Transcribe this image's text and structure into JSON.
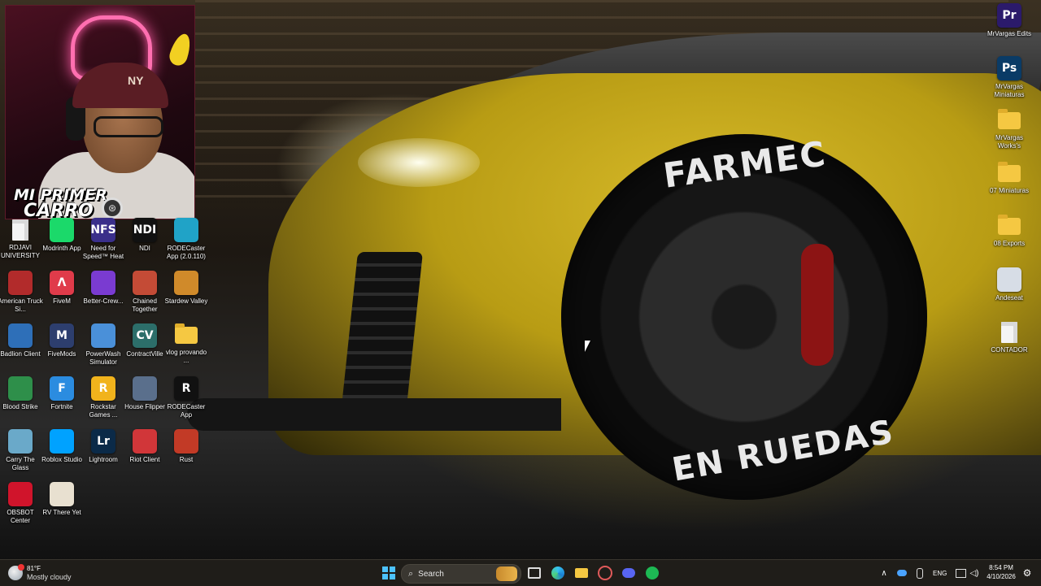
{
  "webcam": {
    "title_line1": "MI PRIMER",
    "title_line2": "CARRO",
    "cap_logo": "NY"
  },
  "wallpaper": {
    "tire_text_top": "FARMEC",
    "tire_text_bottom": "EN RUEDAS"
  },
  "desktop_icons_left": [
    {
      "label": "RDJAVI UNIVERSITY",
      "icon": "document-icon",
      "color": "#f2f2f2"
    },
    {
      "label": "Modrinth App",
      "icon": "modrinth-icon",
      "color": "#1bd96a"
    },
    {
      "label": "Need for Speed™ Heat",
      "icon": "nfs-icon",
      "color": "#3a2f8a",
      "glyph": "NFS"
    },
    {
      "label": "NDI",
      "icon": "ndi-icon",
      "color": "#111111",
      "glyph": "NDI"
    },
    {
      "label": "RODECaster App (2.0.110)",
      "icon": "rodecaster-icon",
      "color": "#20a3c7"
    },
    {
      "label": "American Truck Si...",
      "icon": "truck-icon",
      "color": "#b22b2b"
    },
    {
      "label": "FiveM",
      "icon": "fivem-icon",
      "color": "#e03b4a",
      "glyph": "Λ"
    },
    {
      "label": "Better-Crew...",
      "icon": "bettercrew-icon",
      "color": "#7a3bd1"
    },
    {
      "label": "Chained Together",
      "icon": "chained-icon",
      "color": "#c44b36"
    },
    {
      "label": "Stardew Valley",
      "icon": "stardew-icon",
      "color": "#d08a2a"
    },
    {
      "label": "Badlion Client",
      "icon": "badlion-icon",
      "color": "#2e6fb8"
    },
    {
      "label": "FiveMods",
      "icon": "fivemods-icon",
      "color": "#2d3e6e",
      "glyph": "M"
    },
    {
      "label": "PowerWash Simulator",
      "icon": "powerwash-icon",
      "color": "#4a90d9"
    },
    {
      "label": "ContractVille",
      "icon": "contractville-icon",
      "color": "#2c6e6a",
      "glyph": "CV"
    },
    {
      "label": "vlog provando ...",
      "icon": "folder-icon",
      "color": "#f5c842"
    },
    {
      "label": "Blood Strike",
      "icon": "bloodstrike-icon",
      "color": "#2e8f4a"
    },
    {
      "label": "Fortnite",
      "icon": "fortnite-icon",
      "color": "#2b8ce0",
      "glyph": "F"
    },
    {
      "label": "Rockstar Games ...",
      "icon": "rockstar-icon",
      "color": "#f1b31c",
      "glyph": "R"
    },
    {
      "label": "House Flipper",
      "icon": "houseflipper-icon",
      "color": "#5a6f8c"
    },
    {
      "label": "RODECaster App",
      "icon": "rodecaster-app-icon",
      "color": "#111111",
      "glyph": "R"
    },
    {
      "label": "Carry The Glass",
      "icon": "carryglass-icon",
      "color": "#6aa9c9"
    },
    {
      "label": "Roblox Studio",
      "icon": "roblox-studio-icon",
      "color": "#00a2ff"
    },
    {
      "label": "Lightroom",
      "icon": "lightroom-icon",
      "color": "#0b2a48",
      "glyph": "Lr"
    },
    {
      "label": "Riot Client",
      "icon": "riot-icon",
      "color": "#d13639"
    },
    {
      "label": "Rust",
      "icon": "rust-icon",
      "color": "#c23a26"
    },
    {
      "label": "OBSBOT Center",
      "icon": "obsbot-icon",
      "color": "#d0142b"
    },
    {
      "label": "RV There Yet",
      "icon": "rvthereyet-icon",
      "color": "#e8e0d0"
    }
  ],
  "desktop_icons_right": [
    {
      "label": "MrVargas Edits",
      "icon": "premiere-icon",
      "color": "#2b1a6b",
      "glyph": "Pr"
    },
    {
      "label": "MrVargas Miniaturas",
      "icon": "photoshop-icon",
      "color": "#0a3b66",
      "glyph": "Ps"
    },
    {
      "label": "MrVargas Works's",
      "icon": "folder-icon",
      "color": "#f5c842"
    },
    {
      "label": "07 Miniaturas",
      "icon": "folder-icon",
      "color": "#f5c842"
    },
    {
      "label": "08 Exports",
      "icon": "folder-icon",
      "color": "#f5c842"
    },
    {
      "label": "Andeseat",
      "icon": "andeseat-icon",
      "color": "#d7dde6"
    },
    {
      "label": "CONTADOR",
      "icon": "document-icon",
      "color": "#f2f2f2"
    }
  ],
  "taskbar": {
    "weather_temp": "81°F",
    "weather_condition": "Mostly cloudy",
    "search_placeholder": "Search",
    "language": "ENG",
    "time": "8:54 PM",
    "date": "4/10/2026",
    "apps": [
      {
        "name": "start-button",
        "glyph": ""
      },
      {
        "name": "task-view-button",
        "glyph": "▢"
      },
      {
        "name": "edge-button",
        "glyph": "e"
      },
      {
        "name": "file-explorer-button",
        "glyph": ""
      },
      {
        "name": "snipping-tool-button",
        "glyph": "✂"
      },
      {
        "name": "discord-button",
        "glyph": "☺"
      },
      {
        "name": "spotify-button",
        "glyph": "≋"
      }
    ]
  }
}
